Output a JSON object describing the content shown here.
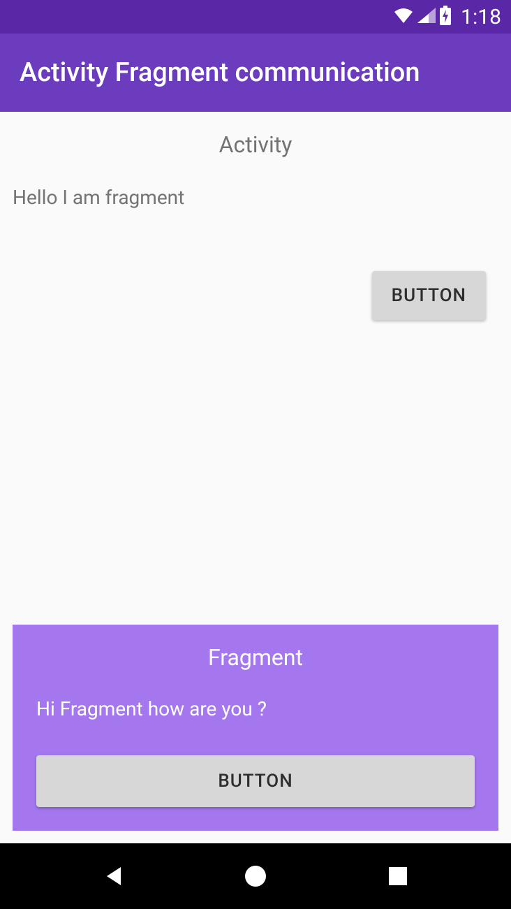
{
  "statusBar": {
    "time": "1:18"
  },
  "appBar": {
    "title": "Activity Fragment communication"
  },
  "activity": {
    "title": "Activity",
    "message": "Hello I am fragment",
    "buttonLabel": "BUTTON"
  },
  "fragment": {
    "title": "Fragment",
    "message": "Hi Fragment how are you ?",
    "buttonLabel": "BUTTON"
  }
}
